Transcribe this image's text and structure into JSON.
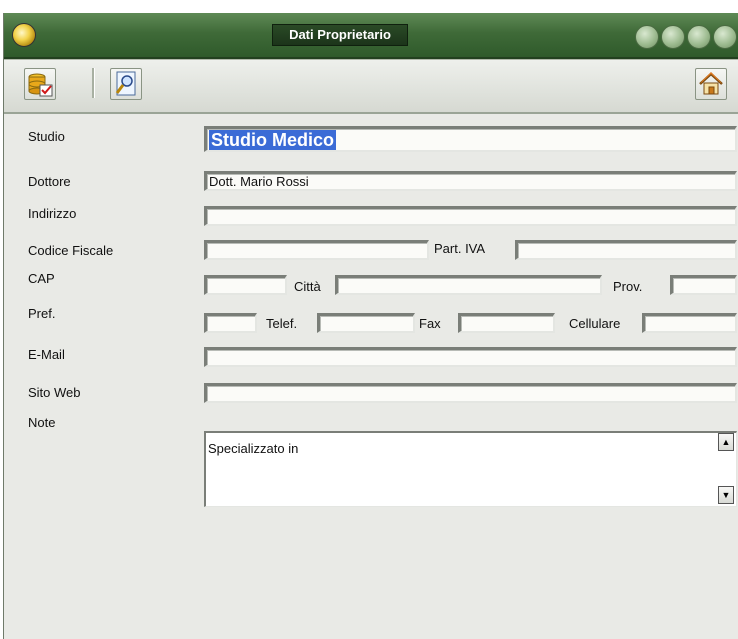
{
  "window": {
    "title": "Dati Proprietario",
    "app_icon": "globe-icon",
    "title_buttons": [
      "window-button",
      "window-button",
      "window-button",
      "window-button"
    ]
  },
  "toolbar": {
    "left_icons": [
      "save-database-icon",
      "preview-document-icon"
    ],
    "right_icons": [
      "home-icon"
    ]
  },
  "form": {
    "studio_label": "Studio",
    "studio_value": "Studio Medico",
    "dottore_label": "Dottore",
    "dottore_value": "Dott. Mario Rossi",
    "indirizzo_label": "Indirizzo",
    "indirizzo_value": "",
    "codice_fiscale_label": "Codice Fiscale",
    "codice_fiscale_value": "",
    "part_iva_label": "Part. IVA",
    "part_iva_value": "",
    "cap_label": "CAP",
    "cap_value": "",
    "citta_label": "Città",
    "citta_value": "",
    "prov_label": "Prov.",
    "prov_value": "",
    "pref_label": "Pref.",
    "pref_value": "",
    "telef_label": "Telef.",
    "telef_value": "",
    "fax_label": "Fax",
    "fax_value": "",
    "cellulare_label": "Cellulare",
    "cellulare_value": "",
    "email_label": "E-Mail",
    "email_value": "",
    "sito_web_label": "Sito Web",
    "sito_web_value": "",
    "note_label": "Note",
    "note_value": "Specializzato in"
  },
  "colors": {
    "title_bar": "#3f6a38",
    "window_bg": "#e9eae6",
    "selection": "#3b6bd6"
  }
}
